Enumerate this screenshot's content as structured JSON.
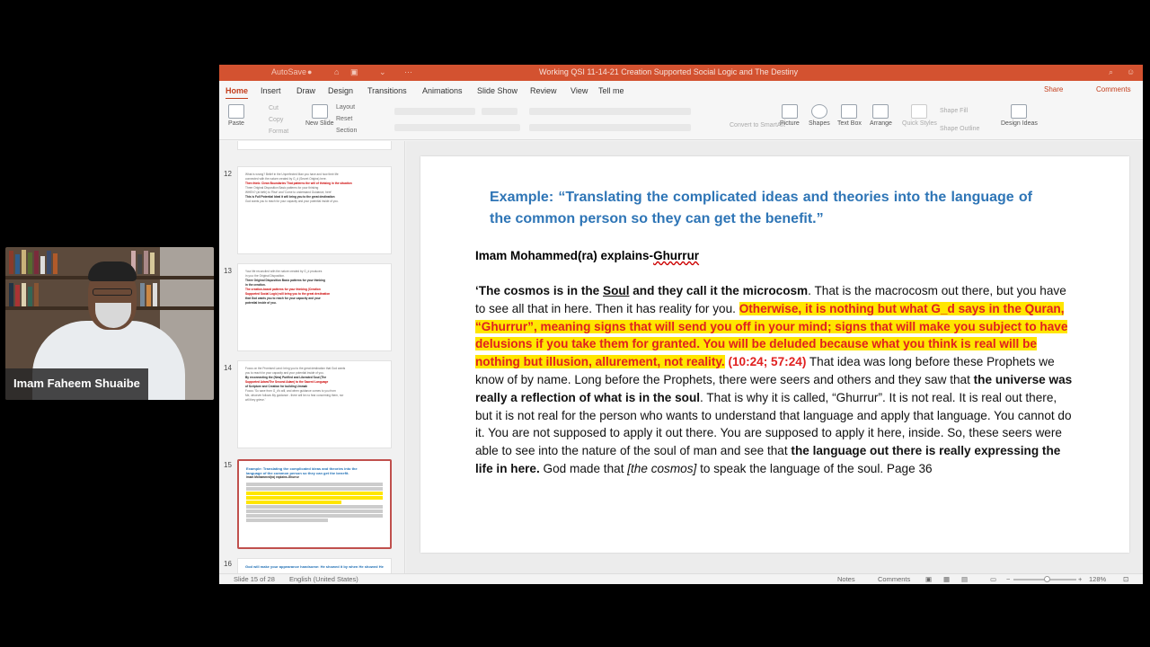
{
  "window": {
    "title": "Working QSI 11-14-21 Creation Supported Social Logic and The Destiny",
    "autosave": "AutoSave"
  },
  "ribbon_tabs": [
    "Home",
    "Insert",
    "Draw",
    "Design",
    "Transitions",
    "Animations",
    "Slide Show",
    "Review",
    "View",
    "Tell me"
  ],
  "share_label": "Share",
  "comments_label": "Comments",
  "ribbon": {
    "paste": "Paste",
    "cut": "Cut",
    "copy": "Copy",
    "format": "Format",
    "new_slide": "New Slide",
    "layout": "Layout",
    "reset": "Reset",
    "section": "Section",
    "convert": "Convert to SmartArt",
    "picture": "Picture",
    "shapes": "Shapes",
    "text_box": "Text Box",
    "arrange": "Arrange",
    "quick_styles": "Quick Styles",
    "shape_fill": "Shape Fill",
    "shape_outline": "Shape Outline",
    "design_ideas": "Design Ideas"
  },
  "thumbnails": [
    {
      "number": "12",
      "lines": [
        "What is wrong? Belief in the Unperfected Man you have and how their life",
        "connected with the nature created by G_d (Secret Origins) here.",
        "Then think: Clean Boundaries That patterns the will of thinking in the situation",
        "Three Original Disposition Basic patterns for your thinking",
        "WHEN? (at birth) to 'Rise' and 'Come to understand Guidance, here'",
        "This is Full Potential Ideal it will bring you to the great destination",
        "God wants you to reach for your capacity and your potential inside of you."
      ]
    },
    {
      "number": "13",
      "lines": [
        "Your life reconciled with the nature created by G_d produces",
        "in you: the Original Disposition.",
        "Three Original Disposition Basic patterns for your thinking",
        "in the creation.",
        "The creation-based patterns for your thinking (Creation",
        "Supported Social Logic) will bring you to the great destination",
        "that God wants you to reach for your capacity and your",
        "potential inside of you."
      ]
    },
    {
      "number": "14",
      "lines": [
        "Focus on the Promised Land: bring you to the great destination that God wants",
        "you to reach for your capacity and your potential inside of you.",
        "By reconnecting the (New) Purified and Liberated Soul (The",
        "Supported Adam/The Second Adam) to the Sacred Language",
        "of Scripture and Creation for building Ummah",
        "Focus: 'So save from G_d's will, and when guidance comes to you from",
        "Me, whoever follows My guidance - there will be no fear concerning them, nor",
        "will they grieve.'"
      ]
    },
    {
      "number": "15",
      "lines": [
        "Example: Translating the complicated ideas and theories into the",
        "language of the common person so they can get the benefit.",
        "Imam Mohammed(ra) explains-Ghurrur"
      ]
    },
    {
      "number": "16",
      "lines": [
        "God will make your appearance handsome: He showed it by when He showed He"
      ]
    }
  ],
  "slide": {
    "title": "Example: “Translating the complicated ideas and theories into the language of the common person so they can get the benefit.”",
    "subtitle_prefix": "Imam Mohammed(ra) explains-",
    "subtitle_word": "Ghurrur",
    "b1": "‘The cosmos is in the ",
    "b1u": "Soul",
    "b1b": " and they call it the microcosm",
    "b2": ". That is the macrocosm out there, but you have to see all that in here. Then it has reality for you.  ",
    "hl": "Otherwise, it is nothing but what G_d says in the Quran, “Ghurrur”, meaning signs that will send you off in your mind; signs that will make you subject to have delusions if you take them for granted. You will be deluded because what you think is real will be nothing but illusion, allurement, not reality.",
    "ref": " (10:24; 57:24)",
    "b3": " That idea was long before these Prophets we know of by name. Long before the Prophets, there were seers and others and they saw that ",
    "b4": "the universe was really a reflection of what is in the soul",
    "b5": ". That is why it is called, “Ghurrur”. It is not real. It is real out there, but it is not real for the person who wants to understand that language and apply that language. You cannot do it. You are not supposed to apply it out there. You are supposed to apply it here, inside. So, these seers were able to see into the nature of the soul of man and see that ",
    "b6": "the language out there is really expressing the life in here.",
    "b7": " God made that ",
    "b8": "[the cosmos]",
    "b9": " to speak the language of the soul. Page 36"
  },
  "statusbar": {
    "slide_count": "Slide 15 of 28",
    "language": "English (United States)",
    "notes": "Notes",
    "comments": "Comments",
    "zoom": "128%"
  },
  "participant": {
    "name": "Imam Faheem Shuaibe"
  },
  "colors": {
    "accent": "#d35230",
    "title_blue": "#2e75b6",
    "highlight": "#ffe600",
    "highlight_text": "#e02020"
  }
}
